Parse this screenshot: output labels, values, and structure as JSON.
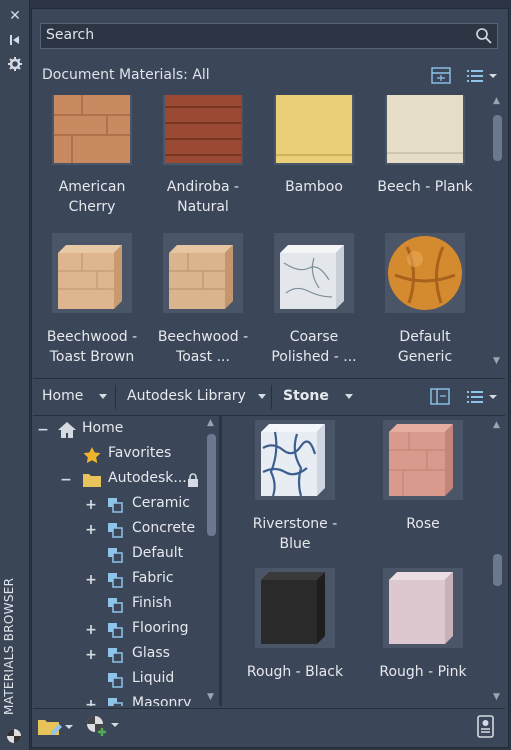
{
  "window": {
    "title": "MATERIALS BROWSER"
  },
  "strip": {
    "close_icon": "close-icon",
    "autohide_icon": "autohide-icon",
    "settings_icon": "gear-icon"
  },
  "search": {
    "placeholder": "Search"
  },
  "document_materials": {
    "header": "Document Materials: All",
    "items": [
      {
        "line1": "American",
        "line2": "Cherry",
        "color": "#c98a62"
      },
      {
        "line1": "Andiroba -",
        "line2": "Natural",
        "color": "#9a4a32"
      },
      {
        "line1": "Bamboo",
        "line2": "",
        "color": "#e9cf78"
      },
      {
        "line1": "Beech - Plank",
        "line2": "",
        "color": "#e6ddc8"
      },
      {
        "line1": "Beechwood -",
        "line2": "Toast Brown",
        "color": "#deb58e"
      },
      {
        "line1": "Beechwood -",
        "line2": "Toast ...",
        "color": "#d9b48c"
      },
      {
        "line1": "Coarse",
        "line2": "Polished - ...",
        "color": "#e3e7eb"
      },
      {
        "line1": "Default",
        "line2": "Generic",
        "color": "#d48a2e"
      }
    ]
  },
  "breadcrumb": {
    "home": "Home",
    "library": "Autodesk Library",
    "category": "Stone"
  },
  "tree": {
    "home": "Home",
    "favorites": "Favorites",
    "library": "Autodesk...",
    "children": [
      "Ceramic",
      "Concrete",
      "Default",
      "Fabric",
      "Finish",
      "Flooring",
      "Glass",
      "Liquid",
      "Masonry"
    ]
  },
  "library_materials": [
    {
      "line1": "Riverstone -",
      "line2": "Blue",
      "color": "#e8edf3"
    },
    {
      "line1": "Rose",
      "line2": "",
      "color": "#d89a8c"
    },
    {
      "line1": "Rough - Black",
      "line2": "",
      "color": "#2a2a2a"
    },
    {
      "line1": "Rough - Pink",
      "line2": "",
      "color": "#ddc8cf"
    }
  ]
}
